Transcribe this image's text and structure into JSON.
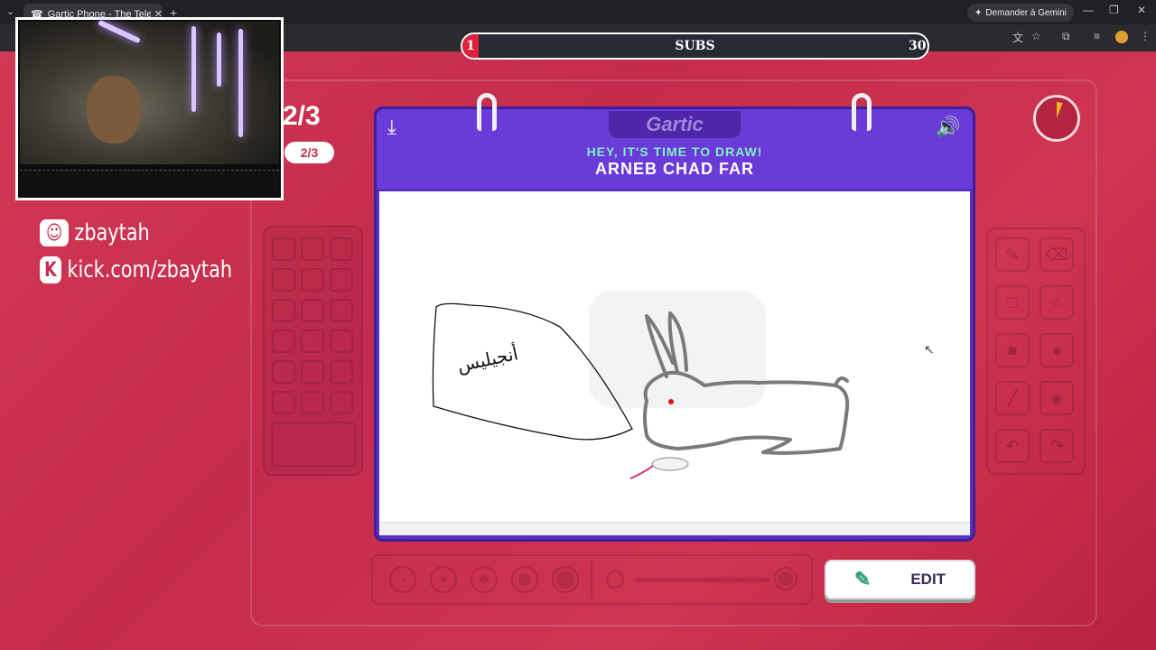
{
  "browser": {
    "tab_title": "Gartic Phone - The Telephone Game",
    "new_tab": "+",
    "tabs_menu": "⌄",
    "tab_close": "✕",
    "gemini_label": "Demander à Gemini",
    "window_minimize": "—",
    "window_restore": "❐",
    "window_close": "✕"
  },
  "subs": {
    "label": "SUBS",
    "current": "1",
    "goal": "30",
    "progress": 0.033
  },
  "streamer": {
    "discord": "zbaytah",
    "kick": "kick.com/zbaytah"
  },
  "game": {
    "round_big": "2/3",
    "round_pill": "2/3",
    "logo": "Gartic",
    "prompt": "HEY, IT'S TIME TO DRAW!",
    "word": "ARNEB CHAD FAR",
    "edit_label": "EDIT",
    "canvas_text": "أنجيليس",
    "timer_progress": 0.06
  },
  "colors": {
    "accent": "#5a2fc4",
    "background": "#c42b4d",
    "prompt": "#7ff0c4",
    "subs_fill": "#e01f3a"
  },
  "icons": {
    "download": "download-icon",
    "volume": "volume-icon",
    "pencil": "pencil-icon",
    "eraser": "eraser-icon"
  }
}
